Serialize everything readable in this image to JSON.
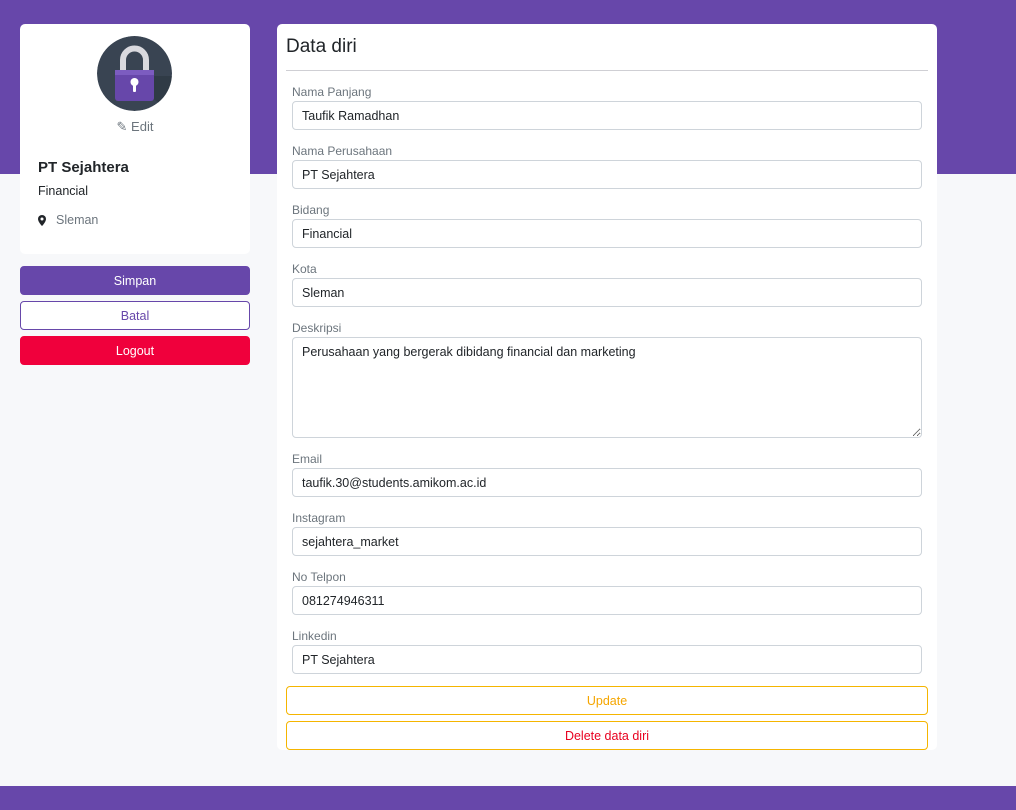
{
  "colors": {
    "brand": "#6747aa",
    "danger": "#f0003c",
    "warning": "#f5b500",
    "background": "#f7f8fa"
  },
  "profile": {
    "avatar_icon": "padlock-icon",
    "edit_label": "✎ Edit",
    "company_name": "PT Sejahtera",
    "field": "Financial",
    "location_icon": "map-pin-icon",
    "location": "Sleman"
  },
  "actions": {
    "save_label": "Simpan",
    "cancel_label": "Batal",
    "logout_label": "Logout"
  },
  "form": {
    "title": "Data diri",
    "fields": [
      {
        "label": "Nama Panjang",
        "value": "Taufik Ramadhan"
      },
      {
        "label": "Nama Perusahaan",
        "value": "PT Sejahtera"
      },
      {
        "label": "Bidang",
        "value": "Financial"
      },
      {
        "label": "Kota",
        "value": "Sleman"
      },
      {
        "label": "Deskripsi",
        "value": "Perusahaan yang bergerak dibidang financial dan marketing"
      },
      {
        "label": "Email",
        "value": "taufik.30@students.amikom.ac.id"
      },
      {
        "label": "Instagram",
        "value": "sejahtera_market"
      },
      {
        "label": "No Telpon",
        "value": "081274946311"
      },
      {
        "label": "Linkedin",
        "value": "PT Sejahtera"
      }
    ],
    "update_label": "Update",
    "delete_label": "Delete data diri"
  }
}
